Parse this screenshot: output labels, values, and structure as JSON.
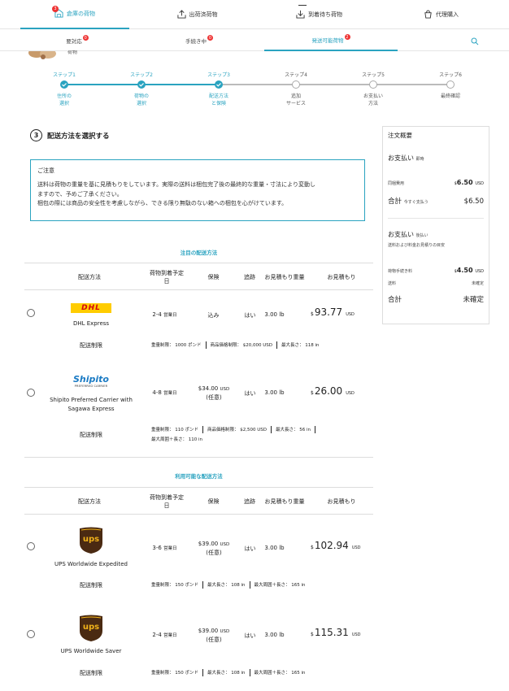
{
  "topnav": {
    "tabs": [
      {
        "label": "倉庫の荷物",
        "badge": "3"
      },
      {
        "label": "出荷済荷物"
      },
      {
        "label": "到着待ち荷物"
      },
      {
        "label": "代理購入"
      }
    ]
  },
  "subnav": {
    "tabs": [
      {
        "label": "要対応",
        "badge": "0"
      },
      {
        "label": "手続き中",
        "badge": "0"
      },
      {
        "label": "発送可能荷物",
        "badge": "2"
      }
    ]
  },
  "stepper": {
    "steps": [
      {
        "step": "ステップ1",
        "label1": "住所の",
        "label2": "選択",
        "done": true
      },
      {
        "step": "ステップ2",
        "label1": "荷物の",
        "label2": "選択",
        "done": true
      },
      {
        "step": "ステップ3",
        "label1": "配送方法",
        "label2": "と保険",
        "done": true
      },
      {
        "step": "ステップ4",
        "label1": "追加",
        "label2": "サービス",
        "done": false
      },
      {
        "step": "ステップ5",
        "label1": "お支払い",
        "label2": "方法",
        "done": false
      },
      {
        "step": "ステップ6",
        "label1": "最終確認",
        "label2": "",
        "done": false
      }
    ]
  },
  "section": {
    "number": "3",
    "title": "配送方法を選択する"
  },
  "notice": {
    "title": "ご注意",
    "line1": "送料は荷物の重量を基に見積もりをしています。実際の送料は梱包完了後の最終的な重量・寸法により変動し",
    "line2": "ますので、予めご了承ください。",
    "line3": "梱包の際には商品の安全性を考慮しながら、できる限り無駄のない箱への梱包を心がけています。"
  },
  "summary": {
    "title": "注文概要",
    "pay_now": "お支払い",
    "pay_now_sub": "即時",
    "service_fee_label": "同梱費用",
    "service_fee": "6.50",
    "service_fee_cur": "$",
    "service_fee_unit": "USD",
    "total_label": "合計",
    "total_sub": "今すぐ支払う",
    "total": "$6.50",
    "pay_later": "お支払い",
    "pay_later_sub": "後払い",
    "pay_later_note": "送料および料金お見積りの目安",
    "handling_label": "荷物手続き料",
    "handling": "4.50",
    "handling_cur": "$",
    "handling_unit": "USD",
    "shipping_label": "送料",
    "shipping": "未確定",
    "total2_label": "合計",
    "total2": "未確定"
  },
  "table_headers": {
    "method": "配送方法",
    "eta1": "荷物到着予定",
    "eta2": "日",
    "insurance": "保険",
    "tracking": "追跡",
    "weight": "お見積もり重量",
    "estimate": "お見積もり"
  },
  "featured": {
    "title": "注目の配送方法",
    "rows": [
      {
        "name": "DHL Express",
        "logo": "DHL",
        "eta": "2-4",
        "eta_unit": "営業日",
        "insurance": "込み",
        "tracking": "はい",
        "weight": "3.00 lb",
        "cur": "$",
        "price": "93.77",
        "unit": "USD",
        "limit_label": "配送制限",
        "limits": [
          "重量制限： 1000 ポンド",
          "商品価格制限： $20,000 USD",
          "最大長さ： 118 in"
        ]
      },
      {
        "name1": "Shipito Preferred Carrier with",
        "name2": "Sagawa Express",
        "logo": "Shipito",
        "logo_sub": "PREFERRED CARRIER",
        "eta": "4-8",
        "eta_unit": "営業日",
        "insurance_price": "$34.00",
        "insurance_unit": "USD",
        "insurance_note": "(任意)",
        "tracking": "はい",
        "weight": "3.00 lb",
        "cur": "$",
        "price": "26.00",
        "unit": "USD",
        "limit_label": "配送制限",
        "limits": [
          "重量制限： 110 ポンド",
          "商品価格制限： $2,500 USD",
          "最大長さ： 56 in",
          "最大周囲＋長さ： 110 in"
        ]
      }
    ]
  },
  "available": {
    "title": "利用可能な配送方法",
    "rows": [
      {
        "name": "UPS Worldwide Expedited",
        "logo": "ups",
        "eta": "3-6",
        "eta_unit": "営業日",
        "insurance_price": "$39.00",
        "insurance_unit": "USD",
        "insurance_note": "(任意)",
        "tracking": "はい",
        "weight": "3.00 lb",
        "cur": "$",
        "price": "102.94",
        "unit": "USD",
        "limit_label": "配送制限",
        "limits": [
          "重量制限： 150 ポンド",
          "最大長さ： 108 in",
          "最大周囲＋長さ： 165 in"
        ]
      },
      {
        "name": "UPS Worldwide Saver",
        "logo": "ups",
        "eta": "2-4",
        "eta_unit": "営業日",
        "insurance_price": "$39.00",
        "insurance_unit": "USD",
        "insurance_note": "(任意)",
        "tracking": "はい",
        "weight": "3.00 lb",
        "cur": "$",
        "price": "115.31",
        "unit": "USD",
        "limit_label": "配送制限",
        "limits": [
          "重量制限： 150 ポンド",
          "最大長さ： 108 in",
          "最大周囲＋長さ： 165 in"
        ]
      }
    ]
  },
  "colors": {
    "accent": "#2aa3c0",
    "badge": "#e33333",
    "dhl_yellow": "#ffcc00",
    "dhl_red": "#d40511",
    "ups_brown": "#4a2a12",
    "ups_gold": "#f0b21a"
  },
  "partial_text": "荷物"
}
